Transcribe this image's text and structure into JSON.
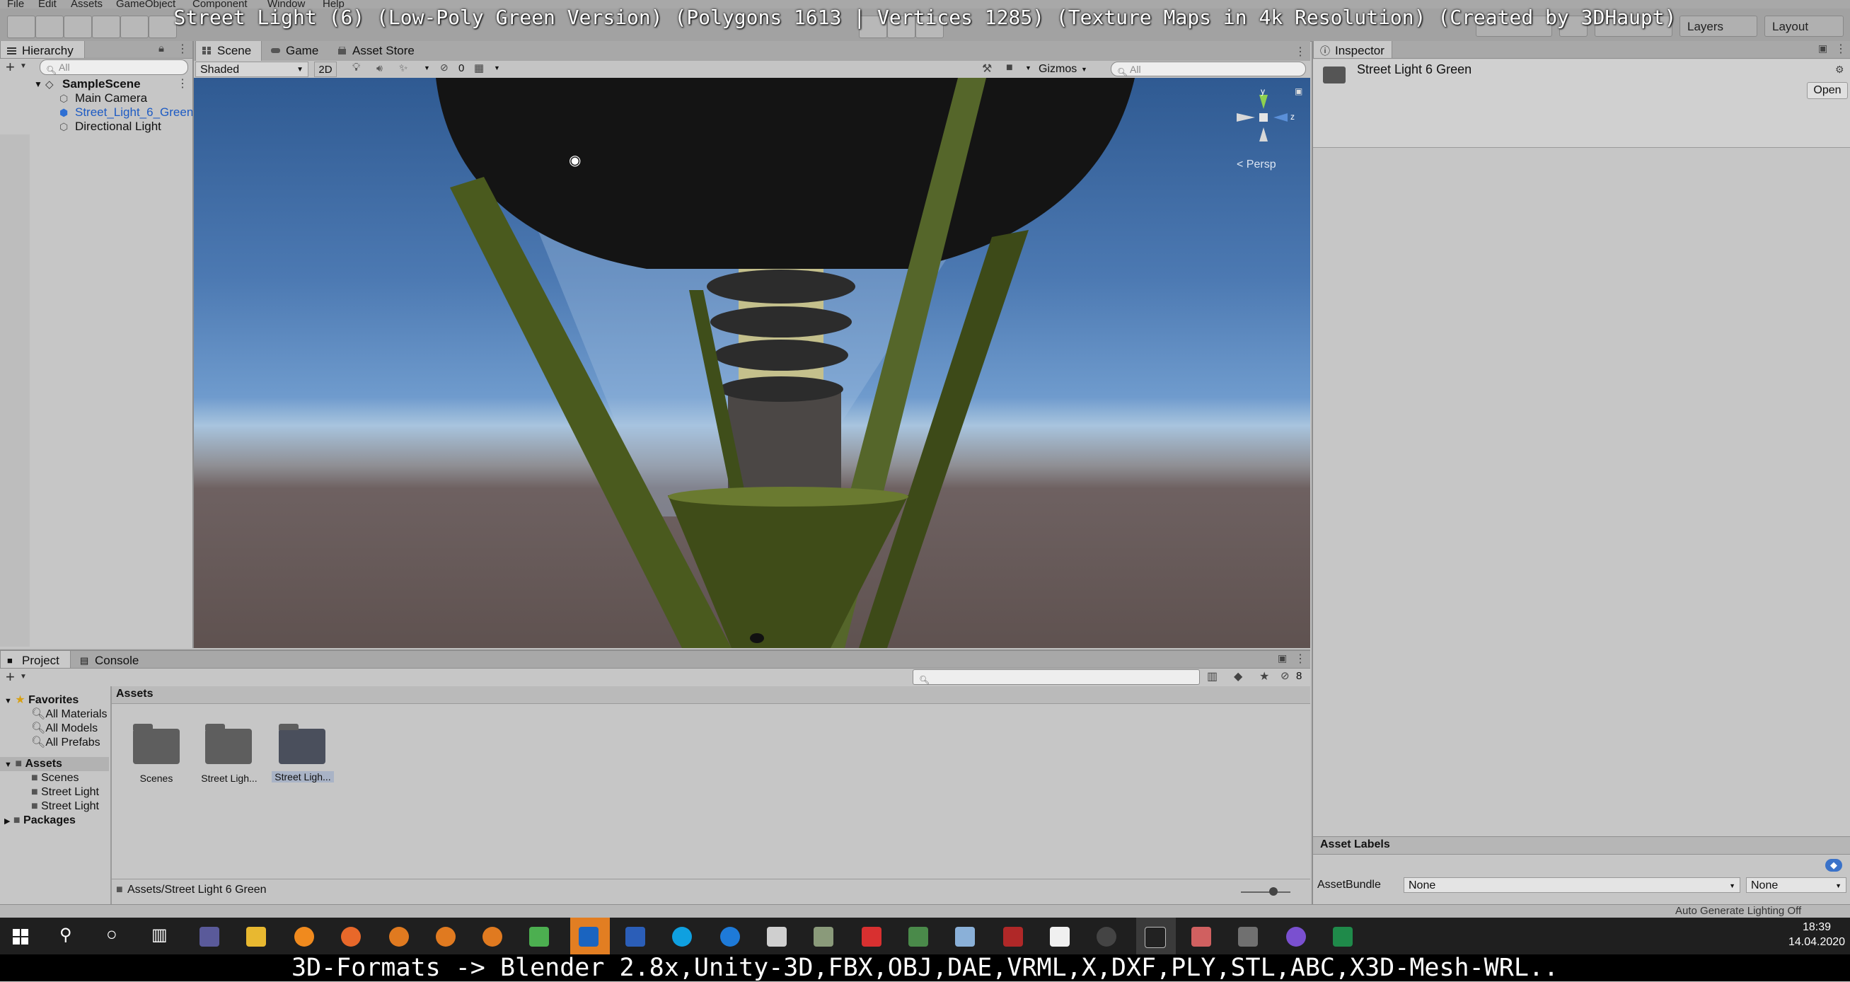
{
  "overlay_title": "Street Light (6) (Low-Poly Green Version) (Polygons 1613 | Vertices 1285) (Texture Maps in 4k Resolution) (Created by 3DHaupt)",
  "menu": [
    "File",
    "Edit",
    "Assets",
    "GameObject",
    "Component",
    "Window",
    "Help"
  ],
  "toolbar": {
    "layers_label": "Layers",
    "layout_label": "Layout"
  },
  "hierarchy": {
    "tab_label": "Hierarchy",
    "search_placeholder": "All",
    "scene_name": "SampleScene",
    "items": [
      {
        "label": "Main Camera",
        "selected": false
      },
      {
        "label": "Street_Light_6_Green",
        "selected": true
      },
      {
        "label": "Directional Light",
        "selected": false
      }
    ]
  },
  "scene": {
    "tabs": [
      {
        "label": "Scene",
        "active": true
      },
      {
        "label": "Game",
        "active": false
      },
      {
        "label": "Asset Store",
        "active": false
      }
    ],
    "shading_mode": "Shaded",
    "mode_2d": "2D",
    "hidden_count": "0",
    "gizmos_label": "Gizmos",
    "search_placeholder": "All",
    "persp_label": "< Persp",
    "axis_y": "y",
    "axis_z": "z"
  },
  "inspector": {
    "tab_label": "Inspector",
    "object_name": "Street Light 6 Green",
    "open_button": "Open",
    "asset_labels_header": "Asset Labels",
    "assetbundle_label": "AssetBundle",
    "assetbundle_value": "None",
    "assetbundle_variant": "None",
    "status_text": "Auto Generate Lighting Off"
  },
  "project": {
    "tabs": [
      {
        "label": "Project",
        "active": true
      },
      {
        "label": "Console",
        "active": false
      }
    ],
    "favorites": {
      "label": "Favorites",
      "items": [
        "All Materials",
        "All Models",
        "All Prefabs"
      ]
    },
    "tree_assets": {
      "label": "Assets",
      "items": [
        "Scenes",
        "Street Light",
        "Street Light"
      ]
    },
    "packages_label": "Packages",
    "content_header": "Assets",
    "folders": [
      {
        "label": "Scenes"
      },
      {
        "label": "Street Ligh..."
      },
      {
        "label": "Street Ligh..."
      }
    ],
    "breadcrumb_path": "Assets/Street Light 6 Green",
    "hidden_count": "8"
  },
  "taskbar": {
    "time": "18:39",
    "date": "14.04.2020"
  },
  "bottom_banner": "3D-Formats -> Blender 2.8x,Unity-3D,FBX,OBJ,DAE,VRML,X,DXF,PLY,STL,ABC,X3D-Mesh-WRL..",
  "colors": {
    "accent": "#3a72c9",
    "selection": "#3e78d4",
    "model_green": "#4a5a1e",
    "lamp_dark": "#141414"
  }
}
